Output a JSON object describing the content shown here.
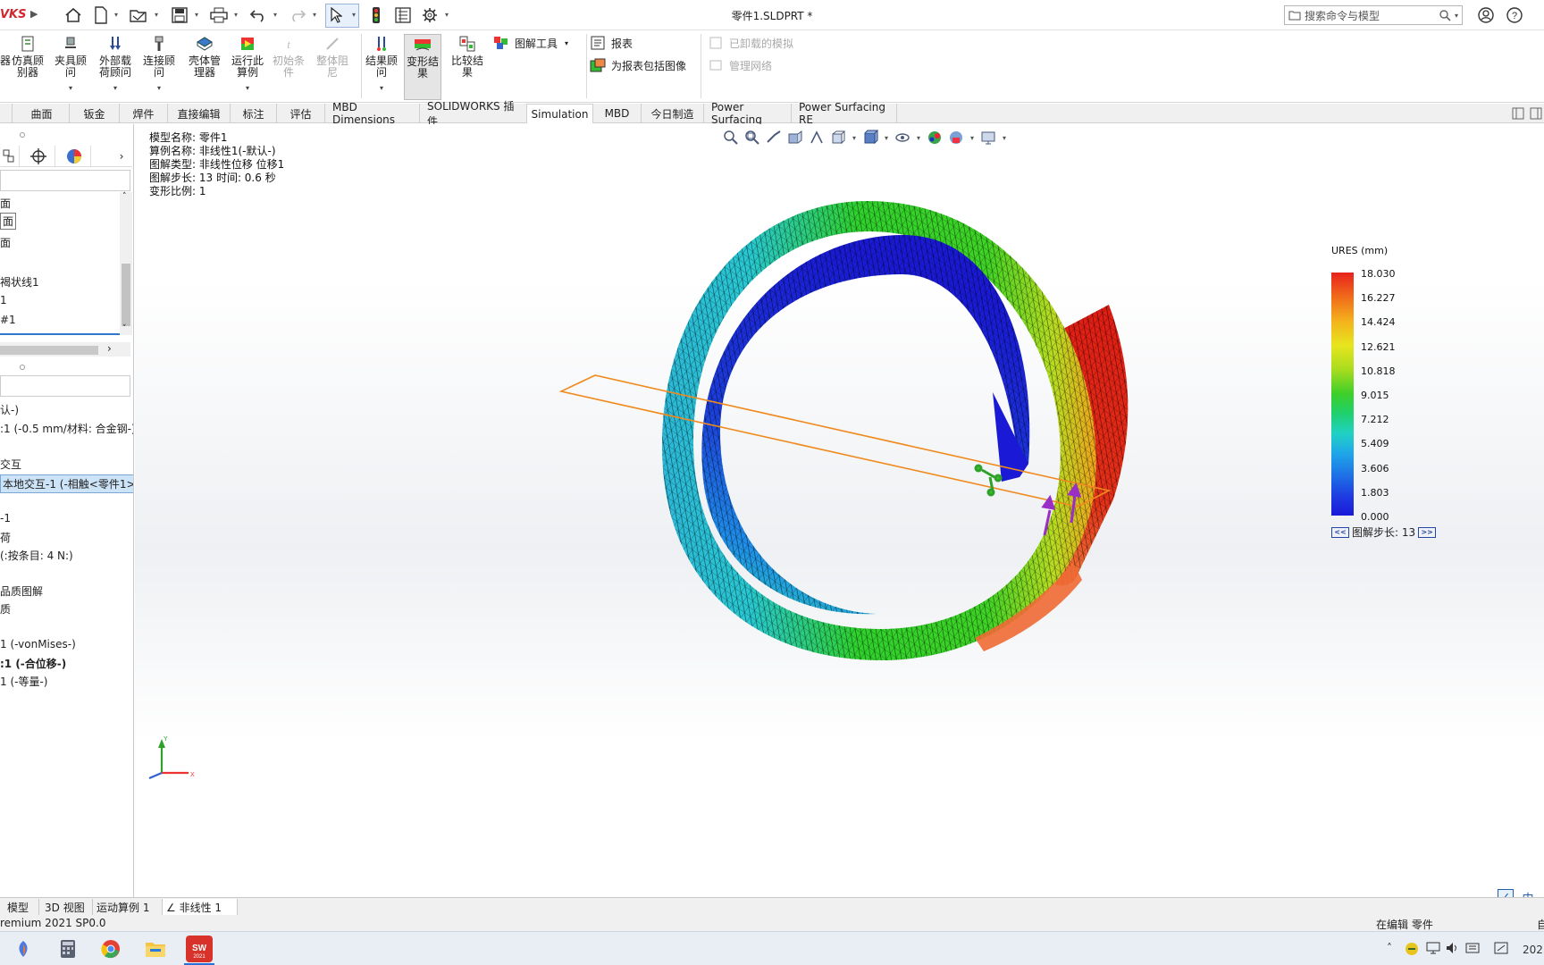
{
  "app": {
    "logo_text": "VKS",
    "document_title": "零件1.SLDPRT *",
    "search_placeholder": "搜索命令与模型"
  },
  "ribbon": {
    "buttons": [
      {
        "label": "仿真顾\n别器",
        "icon": "simulation-advisor-icon",
        "disabled": false
      },
      {
        "label": "夹具顾\n问",
        "icon": "fixtures-advisor-icon",
        "disabled": false
      },
      {
        "label": "外部载\n荷顾问",
        "icon": "external-loads-advisor-icon",
        "disabled": false
      },
      {
        "label": "连接顾\n问",
        "icon": "connections-advisor-icon",
        "disabled": false
      },
      {
        "label": "壳体管\n理器",
        "icon": "shell-manager-icon",
        "disabled": false
      },
      {
        "label": "运行此\n算例",
        "icon": "run-study-icon",
        "disabled": false
      },
      {
        "label": "初始条\n件",
        "icon": "initial-conditions-icon",
        "disabled": true
      },
      {
        "label": "整体阻\n尼",
        "icon": "global-damping-icon",
        "disabled": true
      },
      {
        "label": "结果顾\n问",
        "icon": "results-advisor-icon",
        "disabled": false
      },
      {
        "label": "变形结\n果",
        "icon": "deformed-result-icon",
        "disabled": false
      },
      {
        "label": "比较结\n果",
        "icon": "compare-results-icon",
        "disabled": false
      }
    ],
    "plot_tools": "图解工具",
    "report": "报表",
    "include_image": "为报表包括图像",
    "unloaded_sims": "已卸载的模拟",
    "manage_network": "管理网络"
  },
  "tabs": [
    "曲面",
    "钣金",
    "焊件",
    "直接编辑",
    "标注",
    "评估",
    "MBD Dimensions",
    "SOLIDWORKS 插件",
    "Simulation",
    "MBD",
    "今日制造",
    "Power Surfacing",
    "Power Surfacing RE"
  ],
  "active_tab": "Simulation",
  "feature_tree": [
    "面",
    "面",
    "面",
    "褐状线1",
    "1",
    "#1"
  ],
  "study_tree": {
    "item_default": "认-)",
    "item_shell": ":1 (-0.5 mm/材料: 合金钢-)",
    "item_interaction_group": "交互",
    "item_interaction": "本地交互-1 (-相触<零件1>-",
    "item_fix": "-1",
    "item_load_group": "荷",
    "item_load": "(:按条目: 4 N:)",
    "item_quality": "品质图解",
    "item_results": "质",
    "item_stress": "1 (-vonMises-)",
    "item_disp": ":1 (-合位移-)",
    "item_strain": "1 (-等量-)"
  },
  "viewport": {
    "info_lines": [
      "模型名称: 零件1",
      "算例名称: 非线性1(-默认-)",
      "图解类型: 非线性位移 位移1",
      "图解步长: 13   时间:  0.6 秒",
      "变形比例: 1"
    ],
    "legend_title": "URES (mm)",
    "legend_ticks": [
      "18.030",
      "16.227",
      "14.424",
      "12.621",
      "10.818",
      "9.015",
      "7.212",
      "5.409",
      "3.606",
      "1.803",
      "0.000"
    ],
    "legend_max": 18.03,
    "legend_min": 0.0,
    "step_label": "图解步长: 13",
    "step_prev": "<<",
    "step_next": ">>",
    "colors": {
      "red": "#e22116",
      "green": "#2fd12d",
      "blue": "#1c2fd8",
      "cyan": "#28c6d6",
      "orange_plane": "#f08a1e",
      "arrow": "#9a2fc7",
      "fixture": "#2fa12a"
    }
  },
  "bottom_tabs": [
    "模型",
    "3D 视图",
    "运动算例 1",
    "非线性 1"
  ],
  "active_bottom_tab": "非线性 1",
  "status": {
    "left": "remium 2021 SP0.0",
    "right": "在编辑 零件",
    "right2": "自"
  },
  "taskbar": {
    "clock": "202",
    "ime": "中"
  }
}
